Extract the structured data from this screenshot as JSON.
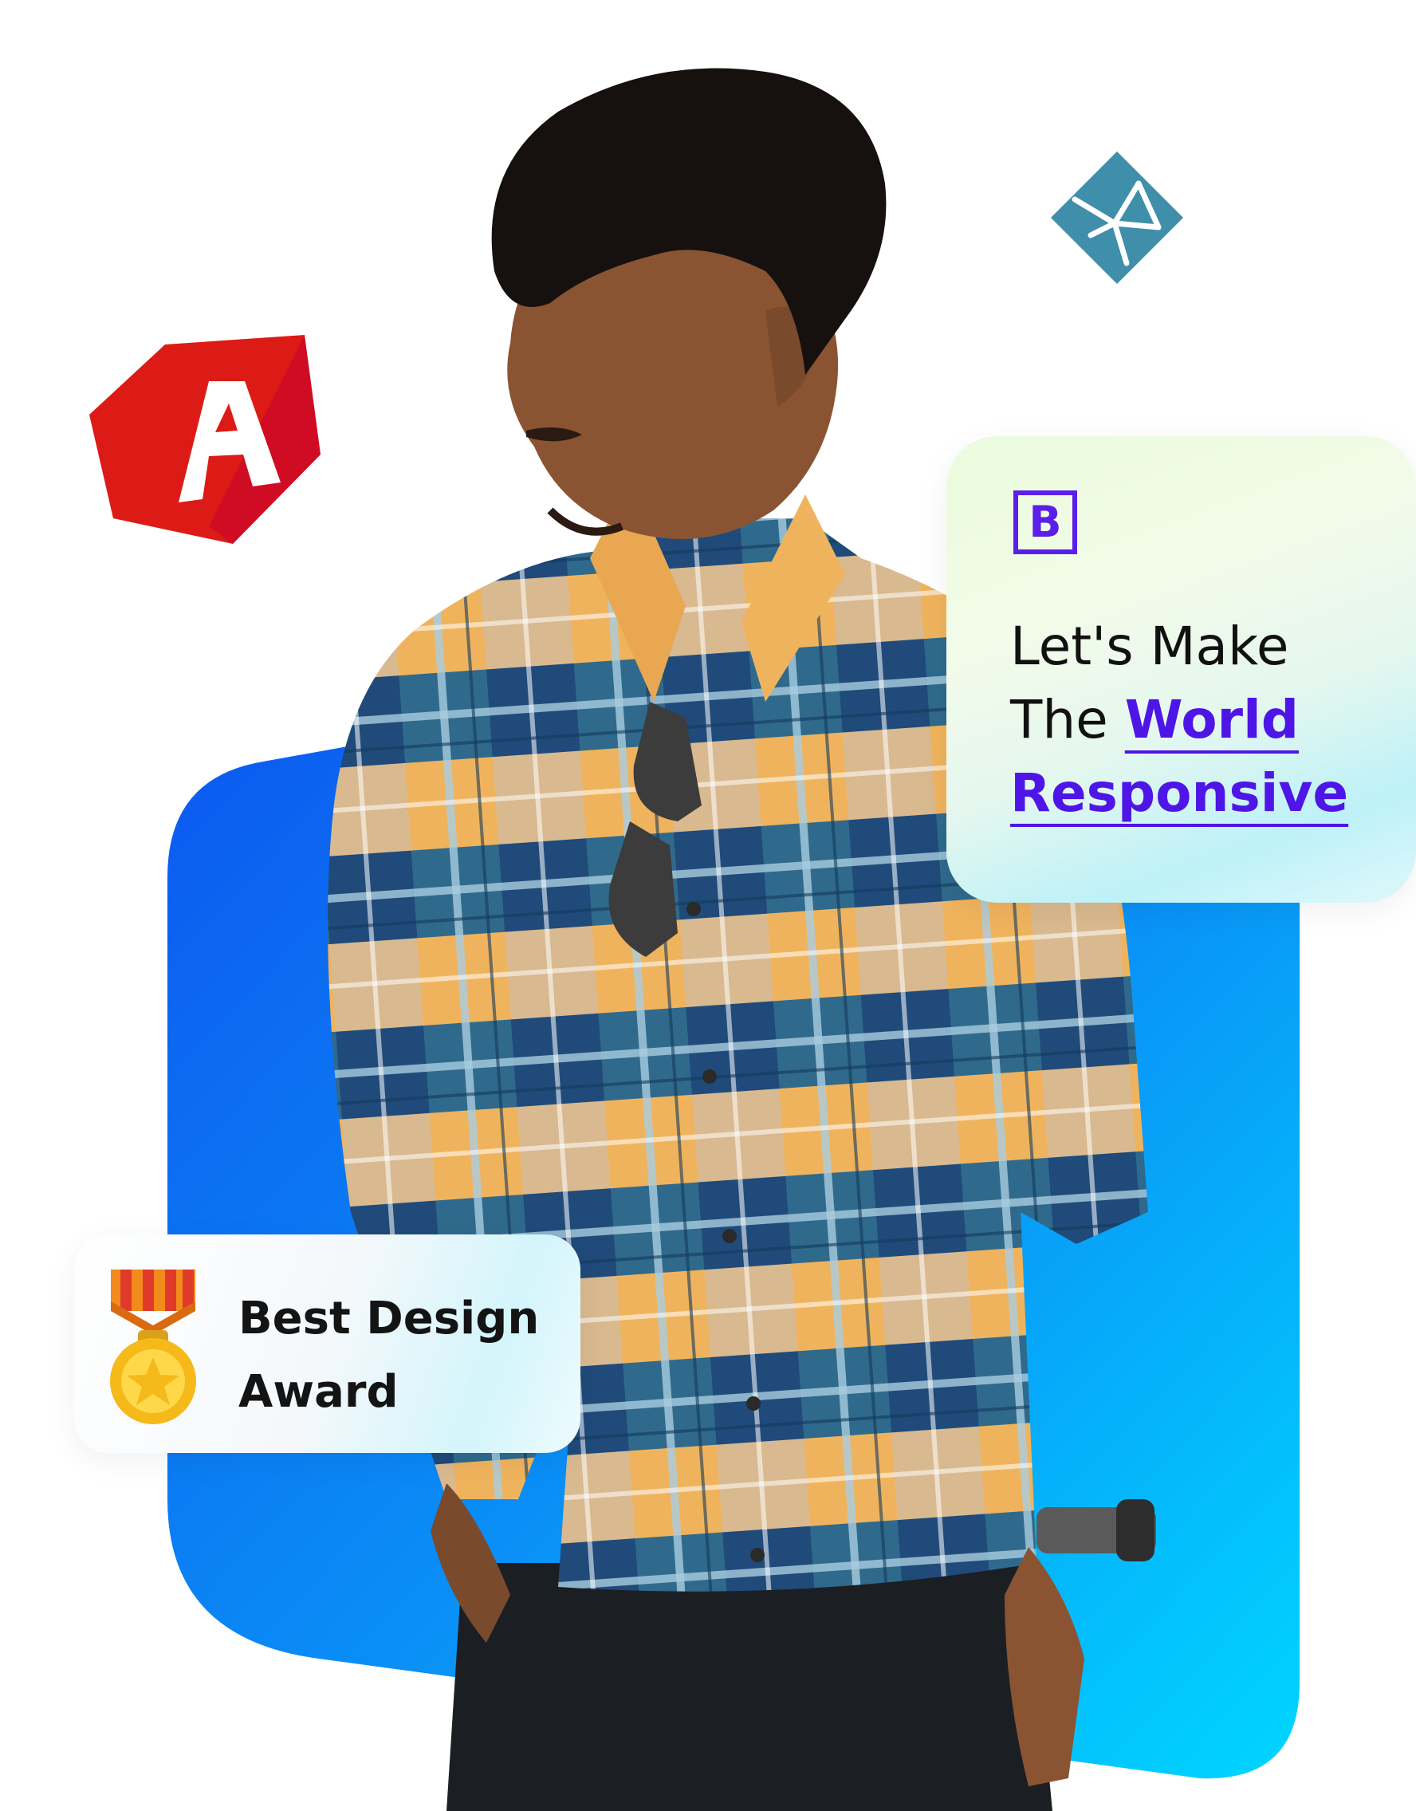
{
  "bootstrap_card": {
    "logo_letter": "B",
    "line1": "Let's Make",
    "line2_prefix": "The",
    "line2_highlight": "World",
    "line3_highlight": "Responsive"
  },
  "award_card": {
    "line1": "Best Design",
    "line2": "Award"
  },
  "colors": {
    "accent": "#4e16e6",
    "blob_start": "#0f5cf0",
    "blob_end": "#00d3ff",
    "angular": "#dd1b16",
    "netlify": "#3f8eaa"
  },
  "icons": [
    "angular-logo-icon",
    "netlify-logo-icon",
    "bootstrap-logo-icon",
    "medal-icon"
  ]
}
